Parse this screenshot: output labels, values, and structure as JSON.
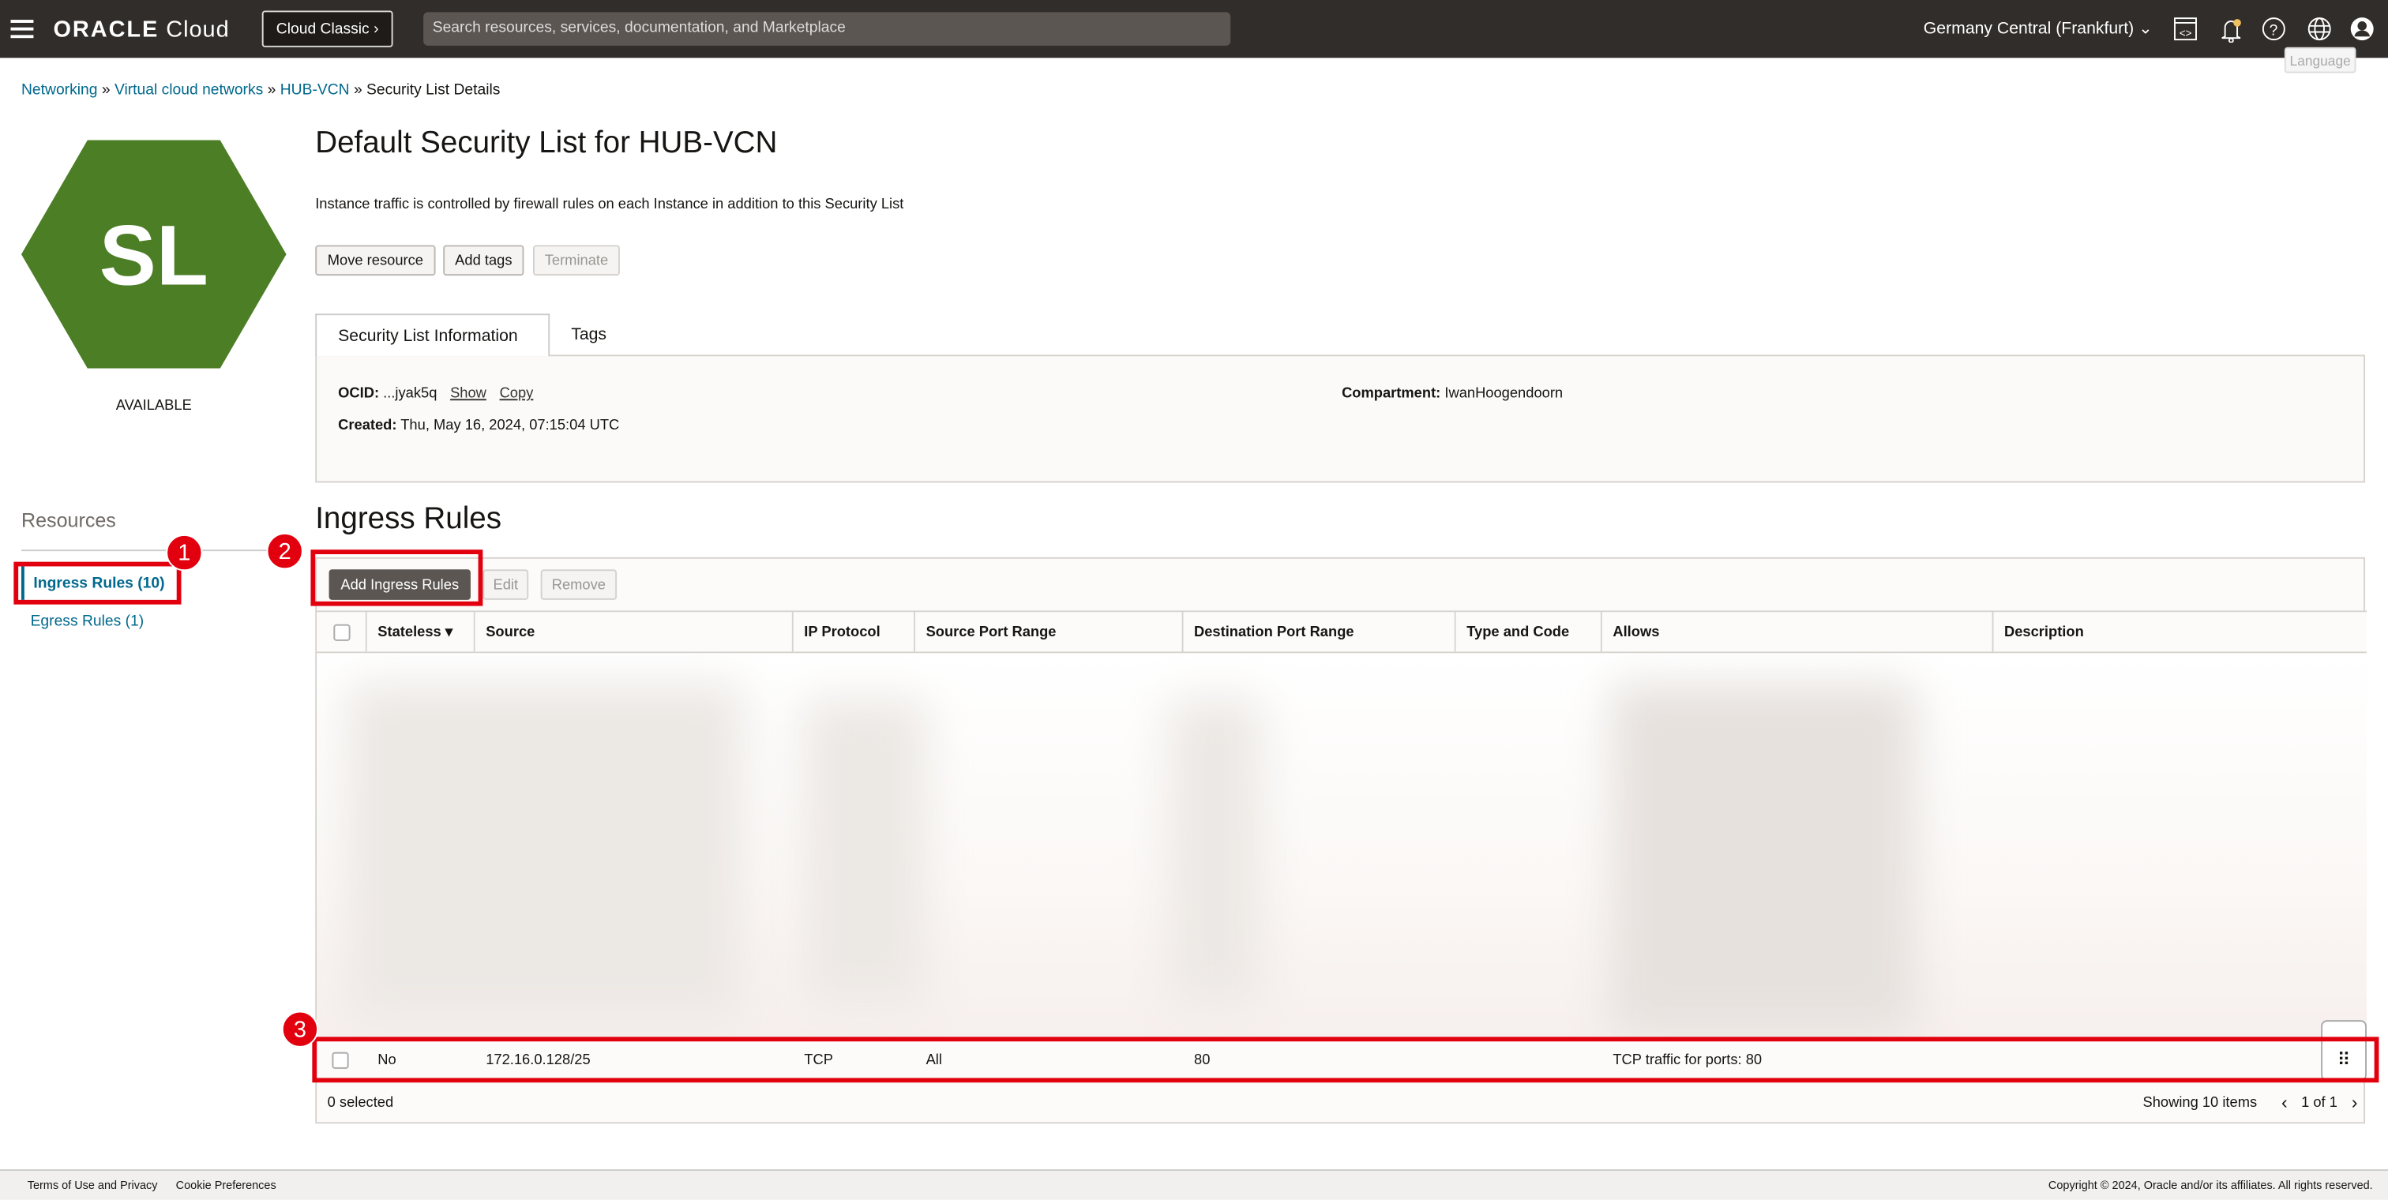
{
  "header": {
    "brand_bold": "ORACLE",
    "brand_light": "Cloud",
    "cloud_classic": "Cloud Classic",
    "search_placeholder": "Search resources, services, documentation, and Marketplace",
    "region": "Germany Central (Frankfurt)",
    "tooltip": "Language"
  },
  "breadcrumb": [
    "Networking",
    "Virtual cloud networks",
    "HUB-VCN",
    "Security List Details"
  ],
  "resource": {
    "icon_text": "SL",
    "status": "AVAILABLE",
    "icon_color": "#4c7e26"
  },
  "page": {
    "title": "Default Security List for HUB-VCN",
    "description": "Instance traffic is controlled by firewall rules on each Instance in addition to this Security List",
    "buttons": [
      "Move resource",
      "Add tags",
      "Terminate"
    ]
  },
  "tabs": [
    "Security List Information",
    "Tags"
  ],
  "info": {
    "ocid_label": "OCID:",
    "ocid_value": "...jyak5q",
    "show": "Show",
    "copy": "Copy",
    "created_label": "Created:",
    "created_value": "Thu, May 16, 2024, 07:15:04 UTC",
    "compartment_label": "Compartment:",
    "compartment_value": "IwanHoogendoorn"
  },
  "sidebar": {
    "title": "Resources",
    "items": [
      {
        "label": "Ingress Rules (10)"
      },
      {
        "label": "Egress Rules (1)"
      }
    ]
  },
  "ingress": {
    "title": "Ingress Rules",
    "buttons": [
      "Add Ingress Rules",
      "Edit",
      "Remove"
    ],
    "columns": [
      "Stateless",
      "Source",
      "IP Protocol",
      "Source Port Range",
      "Destination Port Range",
      "Type and Code",
      "Allows",
      "Description"
    ],
    "row": {
      "stateless": "No",
      "source": "172.16.0.128/25",
      "protocol": "TCP",
      "source_port": "All",
      "dest_port": "80",
      "type_code": "",
      "allows": "TCP traffic for ports: 80",
      "description": ""
    },
    "selected": "0 selected",
    "showing": "Showing 10 items",
    "page": "1 of 1"
  },
  "annotations": [
    "1",
    "2",
    "3"
  ],
  "footer": {
    "links": [
      "Terms of Use and Privacy",
      "Cookie Preferences"
    ],
    "copyright": "Copyright © 2024, Oracle and/or its affiliates. All rights reserved."
  }
}
